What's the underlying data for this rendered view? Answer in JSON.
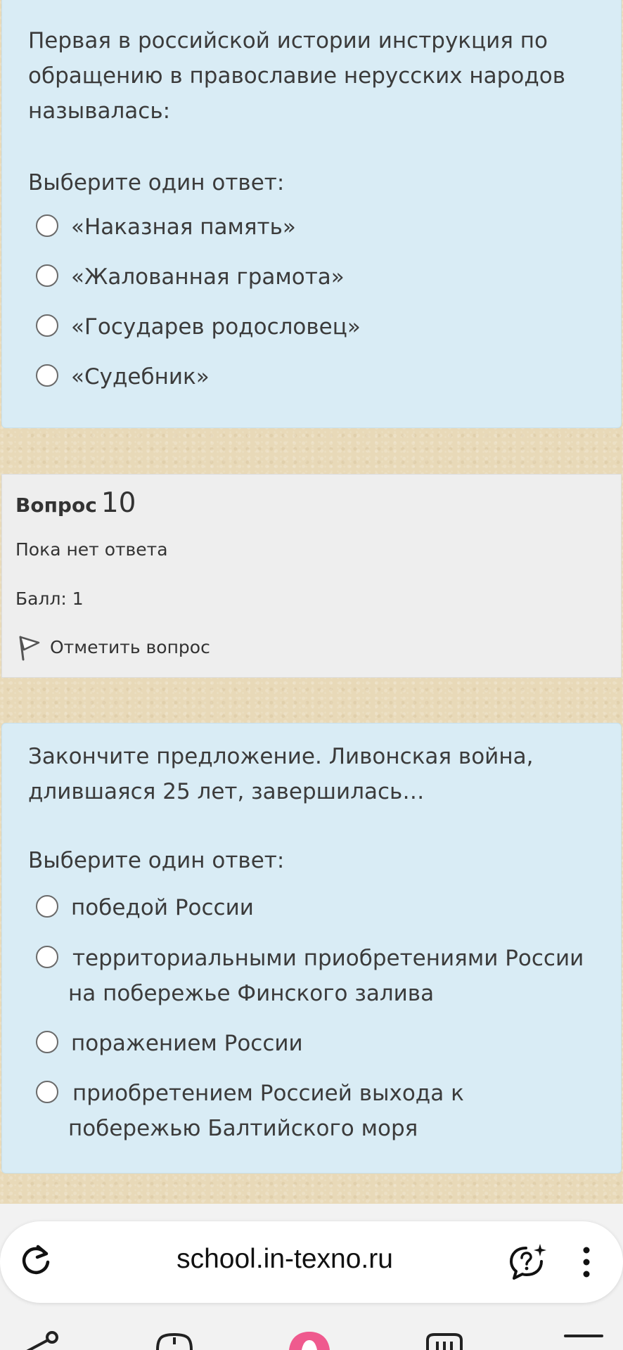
{
  "question9": {
    "text": "Первая в российской истории инструкция по обращению в православие нерусских народов называлась:",
    "prompt": "Выберите один ответ:",
    "options": [
      "«Наказная память»",
      "«Жалованная грамота»",
      "«Государев родословец»",
      "«Судебник»"
    ]
  },
  "question10": {
    "title_word": "Вопрос",
    "number": "10",
    "state": "Пока нет ответа",
    "score": "Балл: 1",
    "flag_label": "Отметить вопрос",
    "text": "Закончите предложение. Ливонская война, длившаяся 25 лет, завершилась…",
    "prompt": "Выберите один ответ:",
    "options": [
      "победой России",
      "территориальными приобретениями России на побережье Финского залива",
      "поражением России",
      "приобретением Россией выхода к побережью Балтийского моря"
    ]
  },
  "browser": {
    "url": "school.in-texno.ru",
    "icons": [
      "reload-icon",
      "assistant-icon",
      "more-menu-icon"
    ]
  },
  "colors": {
    "card_blue": "#d9ecf5",
    "info_gray": "#eeeeee",
    "page_bg": "#e8d9b8"
  }
}
